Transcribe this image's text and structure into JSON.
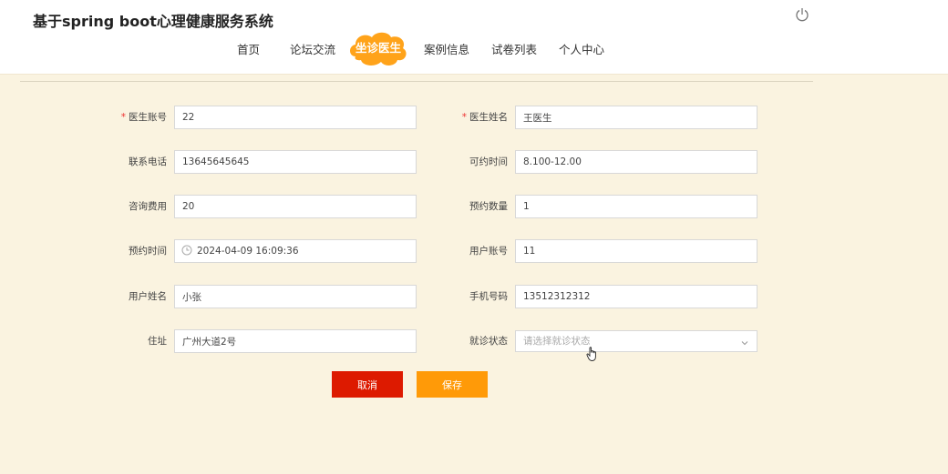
{
  "app": {
    "title": "基于spring boot心理健康服务系统"
  },
  "nav": {
    "items": [
      {
        "label": "首页"
      },
      {
        "label": "论坛交流"
      },
      {
        "label": "坐诊医生",
        "active": true
      },
      {
        "label": "案例信息"
      },
      {
        "label": "试卷列表"
      },
      {
        "label": "个人中心"
      }
    ]
  },
  "form": {
    "doctor_account": {
      "label": "医生账号",
      "required": "*",
      "value": "22"
    },
    "doctor_name": {
      "label": "医生姓名",
      "required": "*",
      "value": "王医生"
    },
    "phone": {
      "label": "联系电话",
      "value": "13645645645"
    },
    "available_time": {
      "label": "可约时间",
      "value": "8.100-12.00"
    },
    "fee": {
      "label": "咨询费用",
      "value": "20"
    },
    "booking_count": {
      "label": "预约数量",
      "value": "1"
    },
    "booking_time": {
      "label": "预约时间",
      "value": "2024-04-09 16:09:36"
    },
    "user_account": {
      "label": "用户账号",
      "value": "11"
    },
    "user_name": {
      "label": "用户姓名",
      "value": "小张"
    },
    "mobile": {
      "label": "手机号码",
      "value": "13512312312"
    },
    "address": {
      "label": "住址",
      "value": "广州大道2号"
    },
    "visit_status": {
      "label": "就诊状态",
      "placeholder": "请选择就诊状态"
    }
  },
  "actions": {
    "cancel_label": "取消",
    "save_label": "保存"
  },
  "colors": {
    "cancel": "#dd1a00",
    "save": "#ff9a08",
    "active_nav": "#ffa31a",
    "page_bg": "#faf3e0"
  }
}
